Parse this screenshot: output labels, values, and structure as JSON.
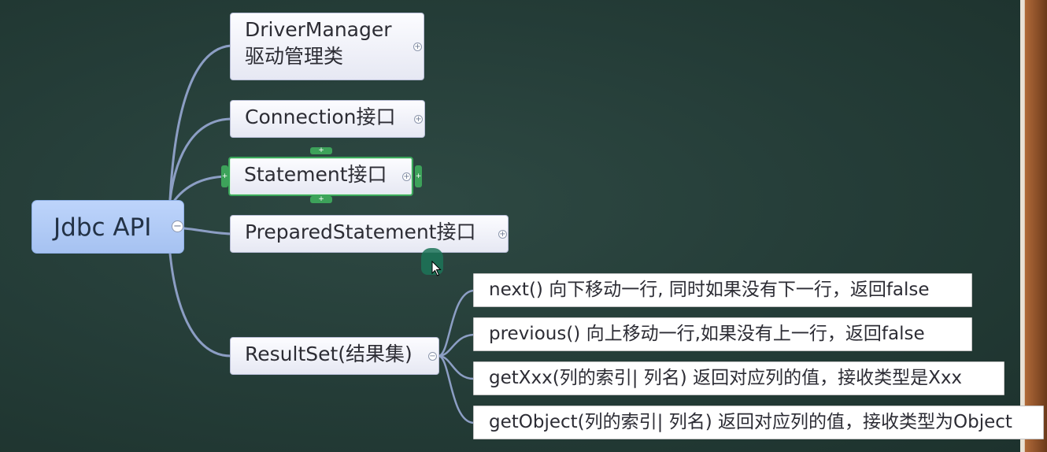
{
  "root": {
    "label": "Jdbc API",
    "collapse_icon": "minus"
  },
  "topics": [
    {
      "line1": "DriverManager",
      "line2": "驱动管理类",
      "toggle_icon": "plus"
    },
    {
      "label": "Connection接口",
      "toggle_icon": "plus"
    },
    {
      "label": "Statement接口",
      "toggle_icon": "plus",
      "selected": true
    },
    {
      "label": "PreparedStatement接口",
      "toggle_icon": "plus"
    },
    {
      "label": "ResultSet(结果集)",
      "toggle_icon": "minus"
    }
  ],
  "resultset_children": [
    {
      "label": "next() 向下移动一行, 同时如果没有下一行，返回false"
    },
    {
      "label": "previous() 向上移动一行,如果没有上一行，返回false"
    },
    {
      "label": "getXxx(列的索引| 列名) 返回对应列的值，接收类型是Xxx"
    },
    {
      "label": "getObject(列的索引| 列名) 返回对应列的值，接收类型为Object"
    }
  ],
  "colors": {
    "board": "#233a35",
    "connector": "#8c9ec4",
    "root_fill": "#a6c2f1",
    "selection": "#3aa65a"
  }
}
